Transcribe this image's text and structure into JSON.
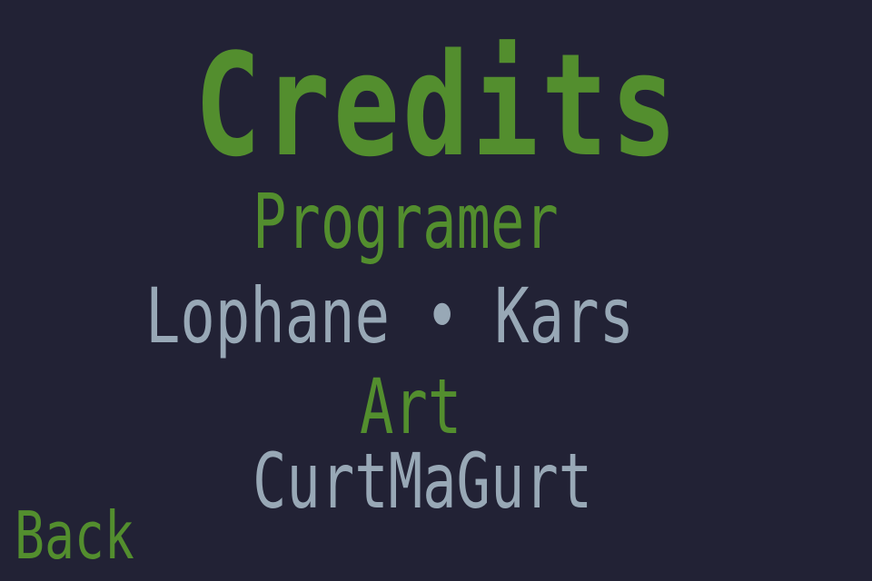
{
  "screen": {
    "title": "Credits",
    "colors": {
      "background": "#222235",
      "accent_green": "#538e2e",
      "name_gray": "#98a8b6"
    }
  },
  "sections": {
    "programer": {
      "heading": "Programer",
      "names": "Lophane • Kars"
    },
    "art": {
      "heading": "Art",
      "names": "CurtMaGurt"
    }
  },
  "nav": {
    "back_label": "Back"
  }
}
